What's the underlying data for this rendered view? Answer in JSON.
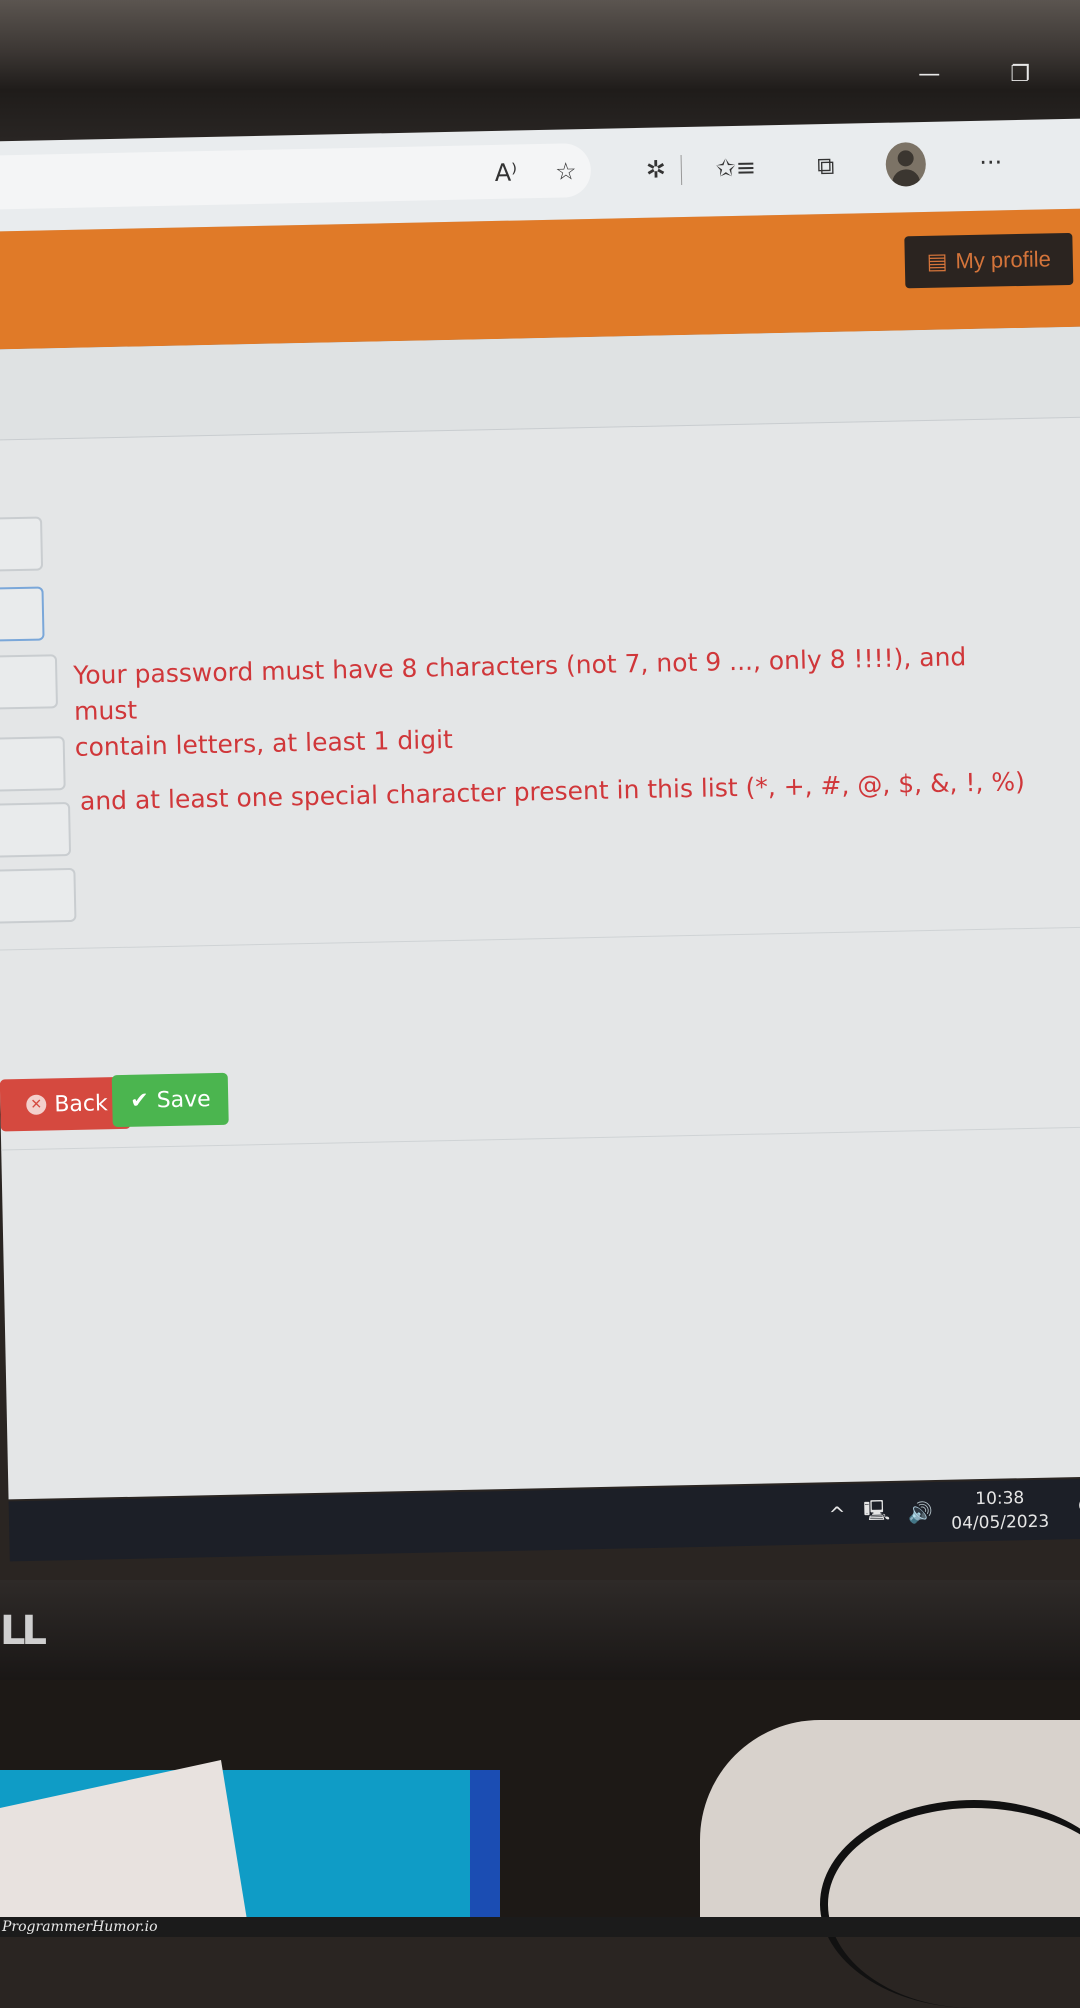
{
  "window": {
    "minimize_icon": "—",
    "restore_icon": "❐"
  },
  "browser_toolbar": {
    "icons": [
      "read-aloud",
      "add-favorite",
      "extensions",
      "favorites",
      "collections",
      "profile",
      "more"
    ],
    "read_aloud_glyph": "A⁾",
    "add_favorite_glyph": "☆",
    "extensions_glyph": "✲",
    "favorites_glyph": "✩≡",
    "collections_glyph": "⧉",
    "more_glyph": "···"
  },
  "site_header": {
    "profile_button_label": "My profile",
    "profile_icon_glyph": "▤",
    "accent_color": "#e07a28"
  },
  "form": {
    "fields_count": 6,
    "validation_message": {
      "line1": "Your password must have 8 characters (not 7, not 9 ..., only 8 !!!!), and must",
      "line2": "contain letters, at least 1 digit",
      "line3": "and at least one special character present in this list (*, +, #, @, $, &, !, %)"
    },
    "message_color": "#d0373a",
    "back_button_label": "Back",
    "save_button_label": "Save"
  },
  "taskbar": {
    "tray_chevron": "^",
    "network_icon": "🖳",
    "volume_icon": "🔊",
    "time": "10:38",
    "date": "04/05/2023",
    "notification_icon": "🗨"
  },
  "monitor": {
    "brand_logo_partial": "LL"
  },
  "watermark": "ProgrammerHumor.io"
}
